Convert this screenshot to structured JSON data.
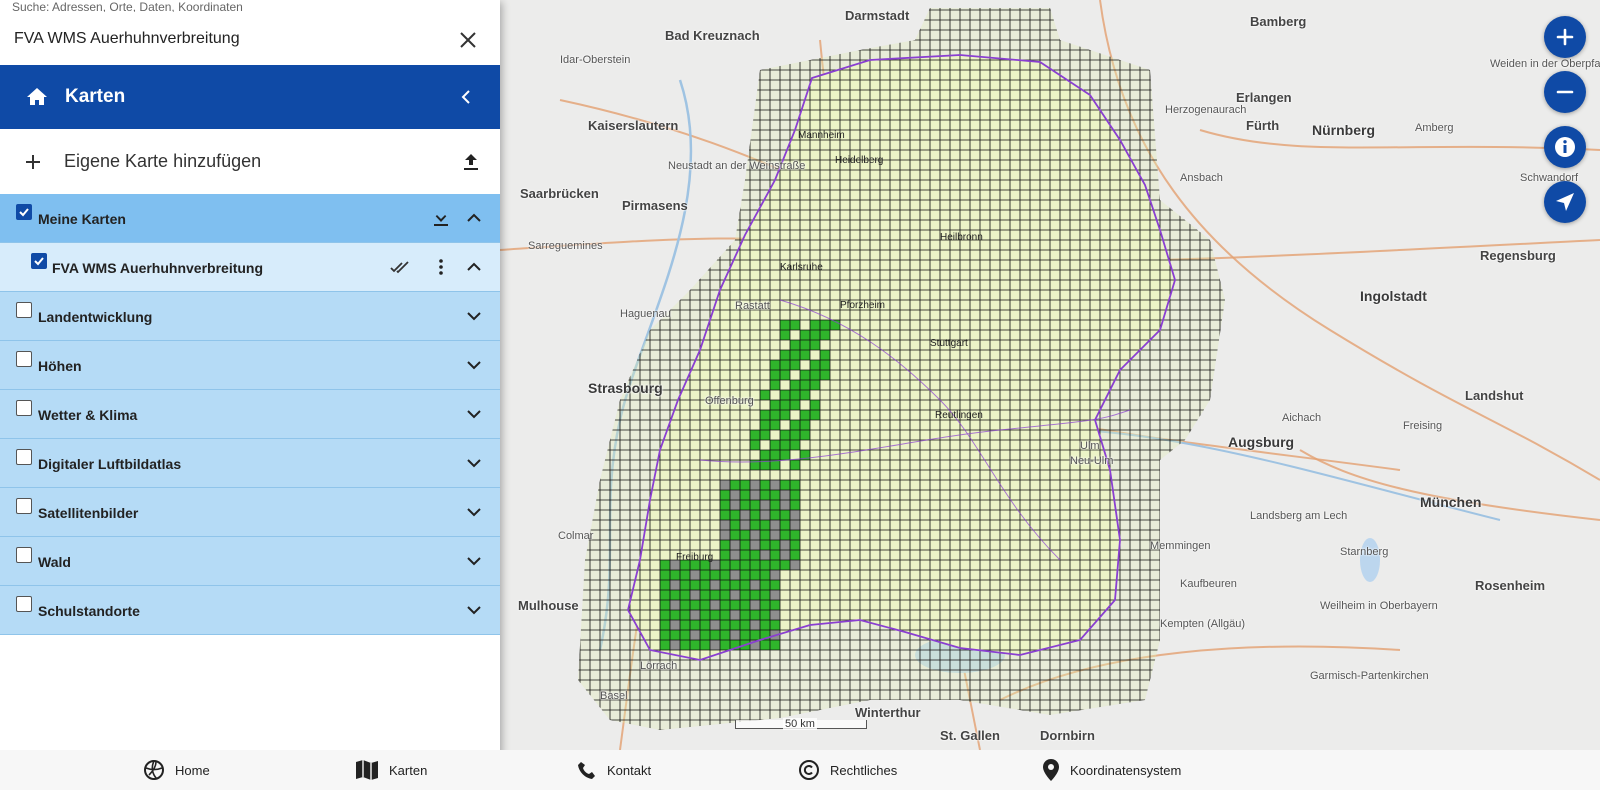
{
  "search": {
    "hint": "Suche: Adressen, Orte, Daten, Koordinaten",
    "value": "FVA WMS Auerhuhnverbreitung"
  },
  "header": {
    "title": "Karten"
  },
  "add_map": {
    "label": "Eigene Karte hinzufügen"
  },
  "groups": {
    "meine_karten": {
      "label": "Meine Karten",
      "checked": true
    },
    "fva_layer": {
      "label": "FVA WMS Auerhuhnverbreitung",
      "checked": true
    },
    "landentwicklung": {
      "label": "Landentwicklung"
    },
    "hoehen": {
      "label": "Höhen"
    },
    "wetter": {
      "label": "Wetter & Klima"
    },
    "luftbild": {
      "label": "Digitaler Luftbildatlas"
    },
    "satellit": {
      "label": "Satellitenbilder"
    },
    "wald": {
      "label": "Wald"
    },
    "schule": {
      "label": "Schulstandorte"
    }
  },
  "bottom_nav": {
    "home": "Home",
    "karten": "Karten",
    "kontakt": "Kontakt",
    "rechtliches": "Rechtliches",
    "koordinaten": "Koordinatensystem"
  },
  "map": {
    "scale_label": "50 km",
    "cities": [
      {
        "name": "Darmstadt",
        "cls": "big"
      },
      {
        "name": "Bamberg",
        "cls": "big"
      },
      {
        "name": "Erlangen",
        "cls": "big"
      },
      {
        "name": "Nürnberg",
        "cls": "xl"
      },
      {
        "name": "Fürth",
        "cls": "big"
      },
      {
        "name": "Regensburg",
        "cls": "big"
      },
      {
        "name": "Ingolstadt",
        "cls": "xl"
      },
      {
        "name": "Augsburg",
        "cls": "xl"
      },
      {
        "name": "München",
        "cls": "xl"
      },
      {
        "name": "Kaiserslautern",
        "cls": "big"
      },
      {
        "name": "Saarbrücken",
        "cls": "big"
      },
      {
        "name": "Pirmasens",
        "cls": "big"
      },
      {
        "name": "Strasbourg",
        "cls": "xl"
      },
      {
        "name": "Mulhouse",
        "cls": "big"
      },
      {
        "name": "Winterthur",
        "cls": "big"
      },
      {
        "name": "St. Gallen",
        "cls": "big"
      },
      {
        "name": "Dornbirn",
        "cls": "big"
      },
      {
        "name": "Rosenheim",
        "cls": "big"
      },
      {
        "name": "Landshut",
        "cls": "big"
      },
      {
        "name": "Bad Kreuznach",
        "cls": "big"
      },
      {
        "name": "Mannheim",
        "cls": "dark"
      },
      {
        "name": "Heidelberg",
        "cls": "dark"
      },
      {
        "name": "Karlsruhe",
        "cls": "dark"
      },
      {
        "name": "Pforzheim",
        "cls": "dark"
      },
      {
        "name": "Stuttgart",
        "cls": "dark"
      },
      {
        "name": "Heilbronn",
        "cls": "dark"
      },
      {
        "name": "Reutlingen",
        "cls": "dark"
      },
      {
        "name": "Freiburg",
        "cls": "dark"
      },
      {
        "name": "Neustadt an der Weinstraße",
        "cls": ""
      },
      {
        "name": "Haguenau",
        "cls": ""
      },
      {
        "name": "Colmar",
        "cls": ""
      },
      {
        "name": "Sarreguemines",
        "cls": ""
      },
      {
        "name": "Idar-Oberstein",
        "cls": ""
      },
      {
        "name": "Amberg",
        "cls": ""
      },
      {
        "name": "Schwandorf",
        "cls": ""
      },
      {
        "name": "Freising",
        "cls": ""
      },
      {
        "name": "Landsberg am Lech",
        "cls": ""
      },
      {
        "name": "Kempten (Allgäu)",
        "cls": ""
      },
      {
        "name": "Weiden in der Oberpfalz",
        "cls": ""
      },
      {
        "name": "Herzogenaurach",
        "cls": ""
      },
      {
        "name": "Ansbach",
        "cls": ""
      },
      {
        "name": "Aichach",
        "cls": ""
      },
      {
        "name": "Memmingen",
        "cls": ""
      },
      {
        "name": "Kaufbeuren",
        "cls": ""
      },
      {
        "name": "Starnberg",
        "cls": ""
      },
      {
        "name": "Weilheim in Oberbayern",
        "cls": ""
      },
      {
        "name": "Garmisch-Partenkirchen",
        "cls": ""
      },
      {
        "name": "Ulm",
        "cls": ""
      },
      {
        "name": "Neu-Ulm",
        "cls": ""
      },
      {
        "name": "Rastatt",
        "cls": ""
      },
      {
        "name": "Offenburg",
        "cls": ""
      },
      {
        "name": "Lörrach",
        "cls": ""
      },
      {
        "name": "Basel",
        "cls": ""
      }
    ]
  },
  "colors": {
    "primary": "#0f4aa6",
    "group_bg": "#b5dbf6",
    "group_active": "#7fbff0",
    "presence": "#2fb52b",
    "uncertain": "#8e8e8e"
  }
}
